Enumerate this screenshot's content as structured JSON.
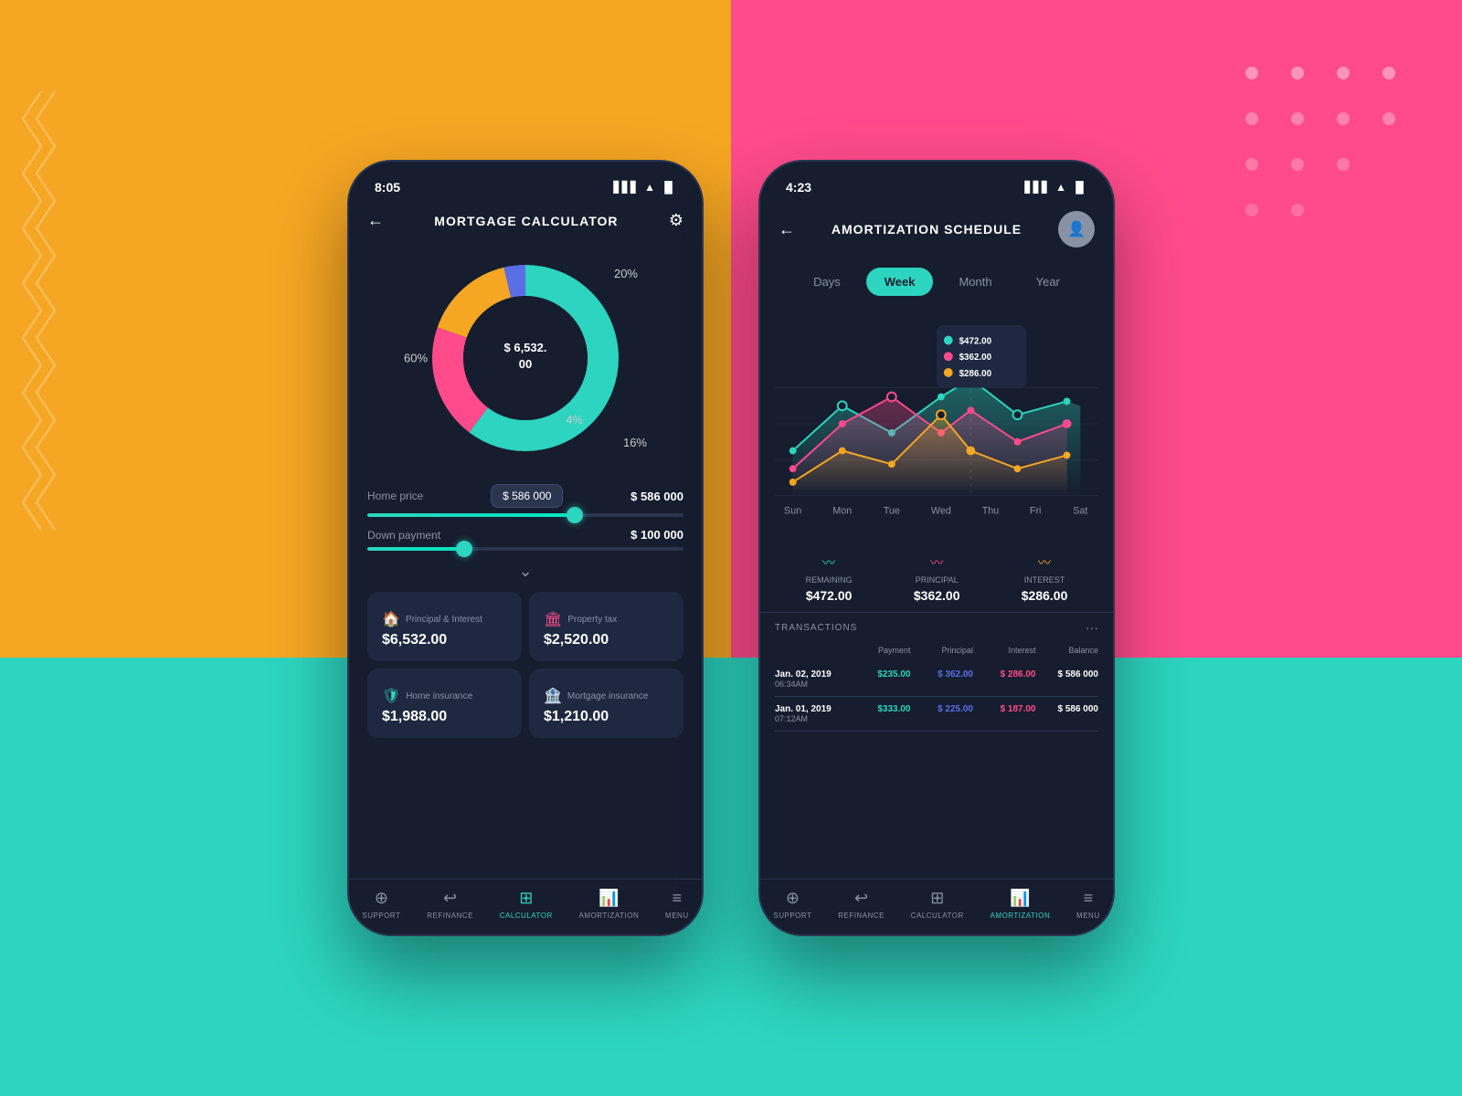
{
  "backgrounds": {
    "orange": "#F5A623",
    "pink": "#FF4B8B",
    "teal": "#2DD4BF"
  },
  "phone1": {
    "status_time": "8:05",
    "title": "MORTGAGE CALCULATOR",
    "donut_amount": "$ 6,532. 00",
    "donut_segments": [
      {
        "label": "60%",
        "color": "#2DD4BF",
        "value": 60
      },
      {
        "label": "20%",
        "color": "#FF4B8B",
        "value": 20
      },
      {
        "label": "16%",
        "color": "#F5A623",
        "value": 16
      },
      {
        "label": "4%",
        "color": "#5B6EE8",
        "value": 4
      }
    ],
    "home_price_label": "Home price",
    "home_price_box": "$ 586 000",
    "home_price_value": "$ 586 000",
    "home_price_slider_pct": 65,
    "down_payment_label": "Down payment",
    "down_payment_value": "$ 100 000",
    "down_payment_slider_pct": 30,
    "cards": [
      {
        "icon": "🏠",
        "icon_color": "#2DD4BF",
        "label": "Principal & Interest",
        "value": "$6,532.00"
      },
      {
        "icon": "🏛",
        "icon_color": "#FF4B8B",
        "label": "Property tax",
        "value": "$2,520.00"
      },
      {
        "icon": "🛡",
        "icon_color": "#2DD4BF",
        "label": "Home insurance",
        "value": "$1,988.00"
      },
      {
        "icon": "🏦",
        "icon_color": "#5B6EE8",
        "label": "Mortgage insurance",
        "value": "$1,210.00"
      }
    ],
    "nav": [
      {
        "label": "SUPPORT",
        "icon": "⊕",
        "active": false
      },
      {
        "label": "REFINANCE",
        "icon": "↩",
        "active": false
      },
      {
        "label": "CALCULATOR",
        "icon": "⊞",
        "active": true
      },
      {
        "label": "AMORTIZATION",
        "icon": "📊",
        "active": false
      },
      {
        "label": "MENU",
        "icon": "≡",
        "active": false
      }
    ]
  },
  "phone2": {
    "status_time": "4:23",
    "title": "AMORTIZATION SCHEDULE",
    "period_tabs": [
      "Days",
      "Week",
      "Month",
      "Year"
    ],
    "active_tab": "Week",
    "tooltip": {
      "values": [
        "$472.00",
        "$362.00",
        "$286.00"
      ],
      "colors": [
        "#2DD4BF",
        "#FF4B8B",
        "#F5A623"
      ]
    },
    "chart_days": [
      "Sun",
      "Mon",
      "Tue",
      "Wed",
      "Thu",
      "Fri",
      "Sat"
    ],
    "stats": [
      {
        "label": "Remaining",
        "value": "$472.00",
        "color": "#2DD4BF"
      },
      {
        "label": "Principal",
        "value": "$362.00",
        "color": "#FF4B8B"
      },
      {
        "label": "Interest",
        "value": "$286.00",
        "color": "#F5A623"
      }
    ],
    "transactions_title": "TRANSACTIONS",
    "transactions": [
      {
        "date": "Jan. 02, 2019",
        "time": "06:34AM",
        "payment": "$235.00",
        "principal": "$ 362.00",
        "interest": "$ 286.00",
        "balance": "$ 586 000"
      },
      {
        "date": "Jan. 01, 2019",
        "time": "07:12AM",
        "payment": "$333.00",
        "principal": "$ 225.00",
        "interest": "$ 187.00",
        "balance": "$ 586 000"
      }
    ],
    "trans_headers": [
      "Payment",
      "Principal",
      "Interest",
      "Balance"
    ],
    "nav": [
      {
        "label": "SUPPORT",
        "icon": "⊕",
        "active": false
      },
      {
        "label": "REFINANCE",
        "icon": "↩",
        "active": false
      },
      {
        "label": "CALCULATOR",
        "icon": "⊞",
        "active": false
      },
      {
        "label": "AMORTIZATION",
        "icon": "📊",
        "active": true
      },
      {
        "label": "MENU",
        "icon": "≡",
        "active": false
      }
    ]
  }
}
